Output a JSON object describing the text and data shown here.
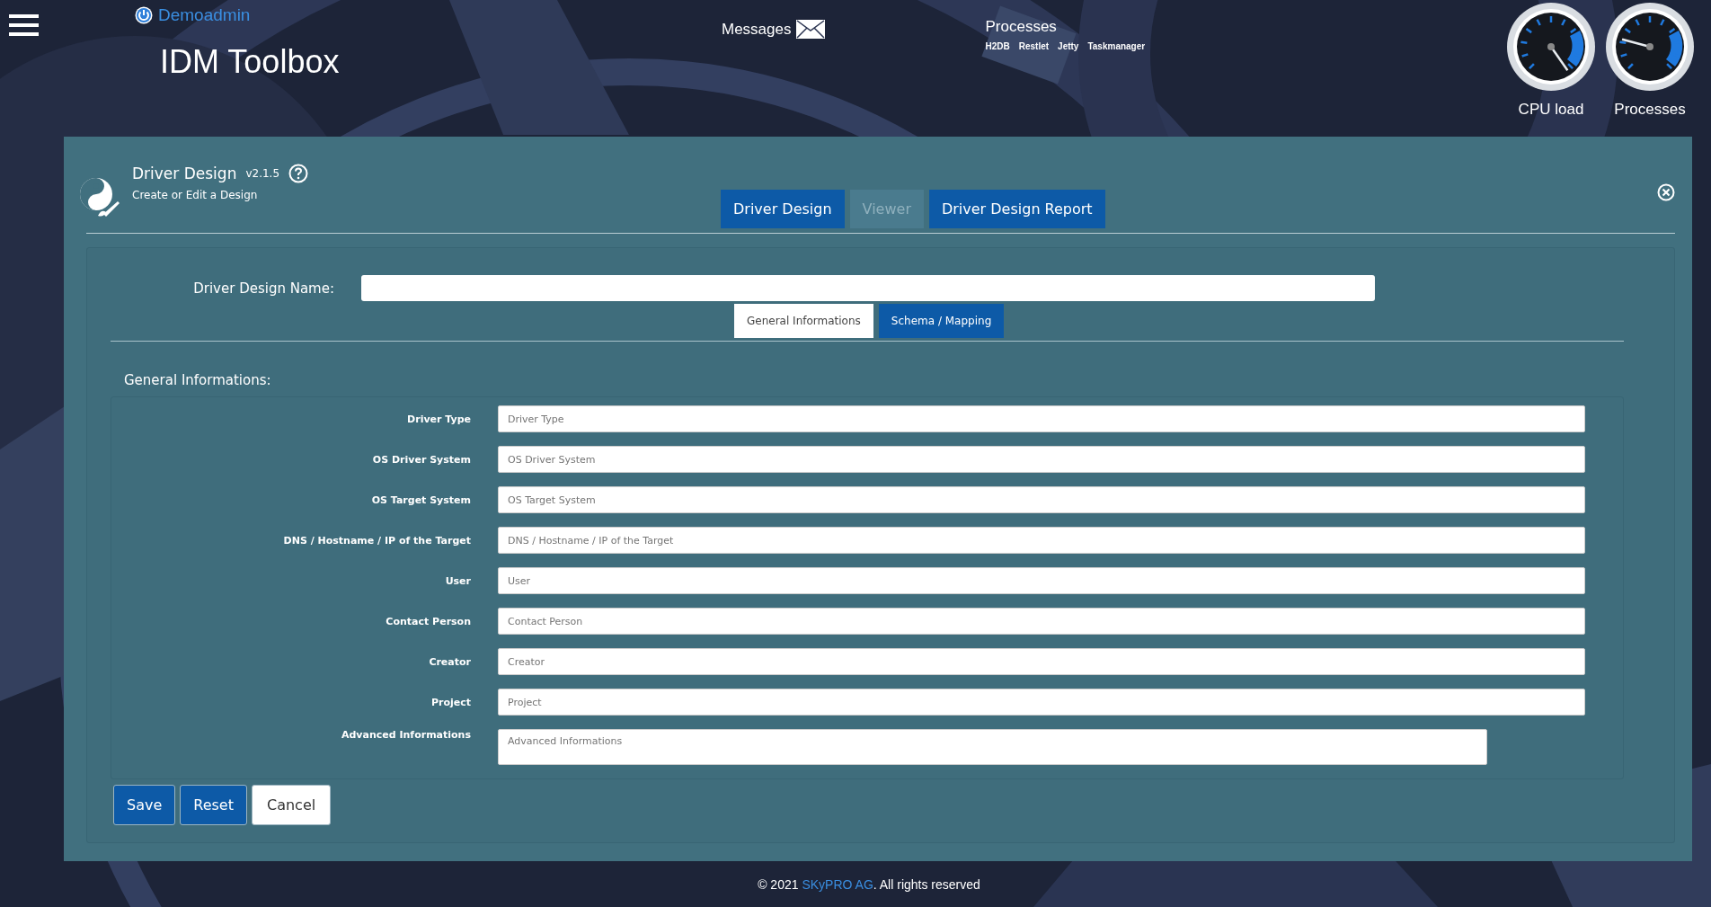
{
  "header": {
    "user": "Demoadmin",
    "title": "IDM Toolbox",
    "messages": "Messages",
    "processes": {
      "title": "Processes",
      "links": [
        "H2DB",
        "Restlet",
        "Jetty",
        "Taskmanager"
      ]
    },
    "gauges": [
      {
        "label": "CPU load"
      },
      {
        "label": "Processes"
      }
    ]
  },
  "panel": {
    "title": "Driver Design",
    "version": "v2.1.5",
    "subtitle": "Create or Edit a Design",
    "tabs": [
      {
        "label": "Driver Design",
        "disabled": false
      },
      {
        "label": "Viewer",
        "disabled": true
      },
      {
        "label": "Driver Design Report",
        "disabled": false
      }
    ],
    "name_label": "Driver Design Name:",
    "subtabs": [
      {
        "label": "General Informations",
        "selected": true
      },
      {
        "label": "Schema / Mapping",
        "selected": false
      }
    ],
    "section_title": "General Informations:",
    "fields": [
      {
        "label": "Driver Type",
        "placeholder": "Driver Type",
        "kind": "input"
      },
      {
        "label": "OS Driver System",
        "placeholder": "OS Driver System",
        "kind": "input"
      },
      {
        "label": "OS Target System",
        "placeholder": "OS Target System",
        "kind": "input"
      },
      {
        "label": "DNS / Hostname / IP of the Target",
        "placeholder": "DNS / Hostname / IP of the Target",
        "kind": "input"
      },
      {
        "label": "User",
        "placeholder": "User",
        "kind": "input"
      },
      {
        "label": "Contact Person",
        "placeholder": "Contact Person",
        "kind": "input"
      },
      {
        "label": "Creator",
        "placeholder": "Creator",
        "kind": "input"
      },
      {
        "label": "Project",
        "placeholder": "Project",
        "kind": "input"
      },
      {
        "label": "Advanced Informations",
        "placeholder": "Advanced Informations",
        "kind": "textarea"
      }
    ],
    "buttons": [
      {
        "label": "Save",
        "kind": "primary"
      },
      {
        "label": "Reset",
        "kind": "primary"
      },
      {
        "label": "Cancel",
        "kind": "secondary"
      }
    ]
  },
  "footer": {
    "prefix": "© 2021 ",
    "company": "SKyPRO AG",
    "suffix": ". All rights reserved"
  }
}
